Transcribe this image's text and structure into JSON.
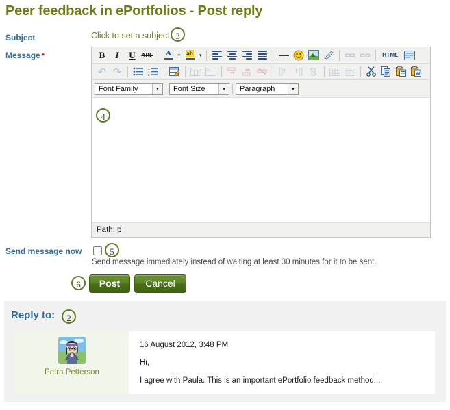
{
  "page": {
    "title": "Peer feedback in ePortfolios - Post reply"
  },
  "form": {
    "subject": {
      "label": "Subject",
      "link_text": "Click to set a subject",
      "marker": "3"
    },
    "message": {
      "label": "Message",
      "required_marker": "*",
      "marker": "4",
      "body_text": ""
    },
    "send_now": {
      "label": "Send message now",
      "checked": false,
      "marker": "5",
      "help_text": "Send message immediately instead of waiting at least 30 minutes for it to be sent."
    },
    "actions": {
      "marker": "6",
      "post_label": "Post",
      "cancel_label": "Cancel"
    }
  },
  "editor": {
    "toolbar_row1": [
      {
        "name": "bold-icon",
        "glyph": "B",
        "style": "gb",
        "dim": false
      },
      {
        "name": "italic-icon",
        "glyph": "I",
        "style": "gi",
        "dim": false
      },
      {
        "name": "underline-icon",
        "glyph": "U",
        "style": "gu",
        "dim": false
      },
      {
        "name": "strikethrough-icon",
        "glyph": "ABC",
        "style": "gs",
        "dim": false
      },
      {
        "name": "separator",
        "glyph": "",
        "style": "sep",
        "dim": false
      },
      {
        "name": "text-color-icon",
        "glyph": "A",
        "style": "color-text",
        "dim": false
      },
      {
        "name": "text-color-dropdown-icon",
        "glyph": "▾",
        "style": "caret",
        "dim": false
      },
      {
        "name": "background-color-icon",
        "glyph": "ab",
        "style": "color-bg",
        "dim": false
      },
      {
        "name": "background-color-dropdown-icon",
        "glyph": "▾",
        "style": "caret",
        "dim": false
      },
      {
        "name": "separator",
        "glyph": "",
        "style": "sep",
        "dim": false
      },
      {
        "name": "align-left-icon",
        "glyph": "",
        "style": "align-left",
        "dim": false
      },
      {
        "name": "align-center-icon",
        "glyph": "",
        "style": "align-center",
        "dim": false
      },
      {
        "name": "align-right-icon",
        "glyph": "",
        "style": "align-right",
        "dim": false
      },
      {
        "name": "align-justify-icon",
        "glyph": "",
        "style": "align-justify",
        "dim": false
      },
      {
        "name": "separator",
        "glyph": "",
        "style": "sep",
        "dim": false
      },
      {
        "name": "horizontal-rule-icon",
        "glyph": "",
        "style": "hr",
        "dim": false
      },
      {
        "name": "emoticon-icon",
        "glyph": "☺",
        "style": "smiley",
        "dim": false
      },
      {
        "name": "insert-image-icon",
        "glyph": "",
        "style": "image",
        "dim": false
      },
      {
        "name": "clean-formatting-icon",
        "glyph": "",
        "style": "broom",
        "dim": false
      },
      {
        "name": "separator",
        "glyph": "",
        "style": "sep",
        "dim": false
      },
      {
        "name": "insert-link-icon",
        "glyph": "",
        "style": "link",
        "dim": true
      },
      {
        "name": "unlink-icon",
        "glyph": "",
        "style": "unlink",
        "dim": true
      },
      {
        "name": "separator",
        "glyph": "",
        "style": "sep",
        "dim": false
      },
      {
        "name": "html-source-icon",
        "glyph": "HTML",
        "style": "html",
        "dim": false
      },
      {
        "name": "fullscreen-icon",
        "glyph": "",
        "style": "fullscreen",
        "dim": false
      }
    ],
    "toolbar_row2": [
      {
        "name": "undo-icon",
        "glyph": "↺",
        "style": "arrow",
        "dim": true
      },
      {
        "name": "redo-icon",
        "glyph": "↻",
        "style": "arrow",
        "dim": true
      },
      {
        "name": "separator",
        "glyph": "",
        "style": "sep",
        "dim": false
      },
      {
        "name": "bullet-list-icon",
        "glyph": "",
        "style": "ul",
        "dim": false
      },
      {
        "name": "numbered-list-icon",
        "glyph": "",
        "style": "ol",
        "dim": false
      },
      {
        "name": "separator",
        "glyph": "",
        "style": "sep",
        "dim": false
      },
      {
        "name": "edit-table-icon",
        "glyph": "",
        "style": "tableedit",
        "dim": false
      },
      {
        "name": "separator",
        "glyph": "",
        "style": "sep",
        "dim": false
      },
      {
        "name": "table-row-properties-icon",
        "glyph": "",
        "style": "tbl",
        "dim": true
      },
      {
        "name": "table-cell-properties-icon",
        "glyph": "",
        "style": "tbl",
        "dim": true
      },
      {
        "name": "separator",
        "glyph": "",
        "style": "sep",
        "dim": false
      },
      {
        "name": "insert-row-before-icon",
        "glyph": "",
        "style": "rowop",
        "dim": true
      },
      {
        "name": "insert-row-after-icon",
        "glyph": "",
        "style": "rowop",
        "dim": true
      },
      {
        "name": "delete-row-icon",
        "glyph": "",
        "style": "rowop",
        "dim": true
      },
      {
        "name": "separator",
        "glyph": "",
        "style": "sep",
        "dim": false
      },
      {
        "name": "insert-column-before-icon",
        "glyph": "",
        "style": "colop",
        "dim": true
      },
      {
        "name": "insert-column-after-icon",
        "glyph": "",
        "style": "colop",
        "dim": true
      },
      {
        "name": "delete-column-icon",
        "glyph": "",
        "style": "colop",
        "dim": true
      },
      {
        "name": "separator",
        "glyph": "",
        "style": "sep",
        "dim": false
      },
      {
        "name": "split-cell-icon",
        "glyph": "",
        "style": "tbl",
        "dim": true
      },
      {
        "name": "merge-cell-icon",
        "glyph": "",
        "style": "tbl",
        "dim": true
      },
      {
        "name": "separator",
        "glyph": "",
        "style": "sep",
        "dim": false
      },
      {
        "name": "cut-icon",
        "glyph": "✂",
        "style": "scissors",
        "dim": false
      },
      {
        "name": "copy-icon",
        "glyph": "",
        "style": "copy",
        "dim": false
      },
      {
        "name": "paste-icon",
        "glyph": "",
        "style": "paste",
        "dim": false
      },
      {
        "name": "paste-from-word-icon",
        "glyph": "",
        "style": "pasteword",
        "dim": false
      }
    ],
    "font_family": "Font Family",
    "font_size": "Font Size",
    "paragraph": "Paragraph",
    "status_path": "Path: p"
  },
  "reply_to": {
    "heading": "Reply to:",
    "marker": "2",
    "post": {
      "author": "Petra Petterson",
      "date": "16 August 2012, 3:48 PM",
      "paragraphs": [
        "Hi,",
        "I agree with Paula. This is an important ePortfolio feedback method..."
      ]
    }
  },
  "colors": {
    "title": "#6d7b16",
    "label": "#2f6e9e",
    "link": "#6d7b16",
    "required": "#d40000",
    "marker_ring": "#5e7a26",
    "button": "#4b7019",
    "panel_bg": "#f1f1f1"
  }
}
